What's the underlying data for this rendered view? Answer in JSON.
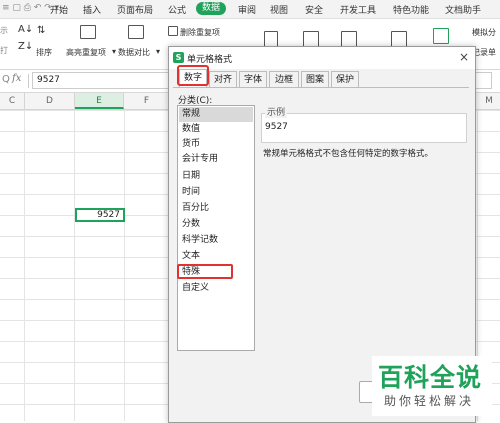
{
  "menubar": {
    "items": [
      "开始",
      "插入",
      "页面布局",
      "公式",
      "数据",
      "审阅",
      "视图",
      "安全",
      "开发工具",
      "特色功能",
      "文档助手"
    ],
    "active_index": 4,
    "accent": "#1fa25a"
  },
  "ribbon": {
    "left_text": "示",
    "left_text2": "打",
    "sort_label": "排序",
    "highlight_dup_label": "高亮重复项",
    "compare_label": "数据对比",
    "delete_dup_label": "删除重复项",
    "right_label": "模拟分",
    "right_label2": "记录单"
  },
  "formula_bar": {
    "fx": "fx",
    "value": "9527",
    "zoom_glyph": "Q"
  },
  "grid": {
    "columns": [
      "C",
      "D",
      "E",
      "F",
      "M"
    ],
    "selected_column": "E",
    "cell_value": "9527"
  },
  "dialog": {
    "title": "单元格格式",
    "logo_letter": "S",
    "close": "×",
    "tabs": [
      "数字",
      "对齐",
      "字体",
      "边框",
      "图案",
      "保护"
    ],
    "active_tab": 0,
    "category_label": "分类(C):",
    "categories": [
      "常规",
      "数值",
      "货币",
      "会计专用",
      "日期",
      "时间",
      "百分比",
      "分数",
      "科学记数",
      "文本",
      "特殊",
      "自定义"
    ],
    "selected_category": 0,
    "highlighted_category": 10,
    "sample_label": "示例",
    "sample_value": "9527",
    "description": "常规单元格格式不包含任何特定的数字格式。"
  },
  "watermark": {
    "big": "百科全说",
    "small": "助你轻松解决"
  }
}
